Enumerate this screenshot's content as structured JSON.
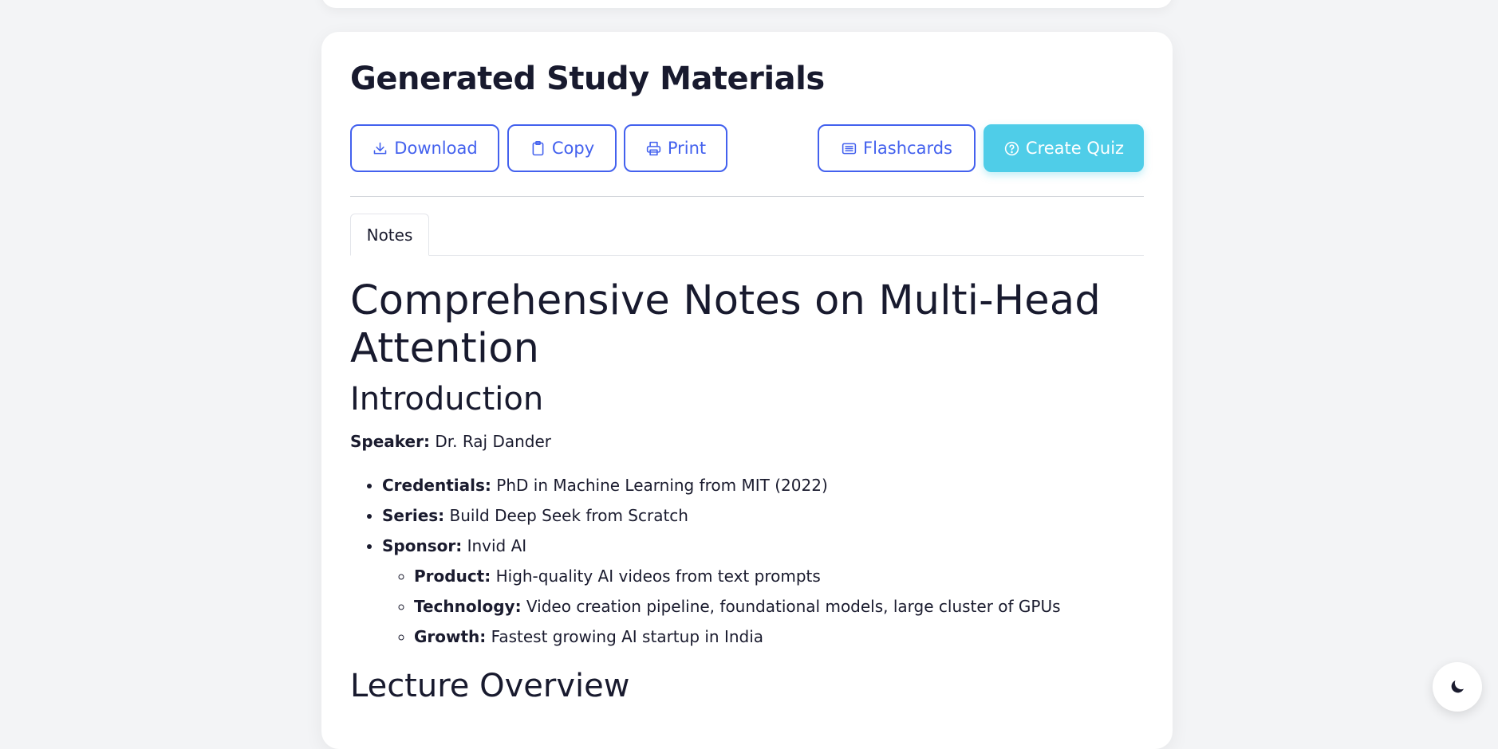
{
  "card": {
    "title": "Generated Study Materials"
  },
  "toolbar": {
    "download_label": "Download",
    "copy_label": "Copy",
    "print_label": "Print",
    "flashcards_label": "Flashcards",
    "quiz_label": "Create Quiz"
  },
  "tabs": [
    {
      "label": "Notes",
      "active": true
    }
  ],
  "notes": {
    "title": "Comprehensive Notes on Multi-Head Attention",
    "intro_heading": "Introduction",
    "speaker_label": "Speaker:",
    "speaker_value": " Dr. Raj Dander",
    "items": [
      {
        "label": "Credentials:",
        "value": " PhD in Machine Learning from MIT (2022)"
      },
      {
        "label": "Series:",
        "value": " Build Deep Seek from Scratch"
      },
      {
        "label": "Sponsor:",
        "value": " Invid AI"
      }
    ],
    "sponsor_details": [
      {
        "label": "Product:",
        "value": " High-quality AI videos from text prompts"
      },
      {
        "label": "Technology:",
        "value": " Video creation pipeline, foundational models, large cluster of GPUs"
      },
      {
        "label": "Growth:",
        "value": " Fastest growing AI startup in India"
      }
    ],
    "overview_heading": "Lecture Overview"
  },
  "icons": {
    "download": "download-icon",
    "copy": "clipboard-icon",
    "print": "printer-icon",
    "flashcards": "list-card-icon",
    "quiz": "question-circle-icon",
    "theme": "moon-icon"
  },
  "colors": {
    "accent": "#4361ee",
    "quiz_bg": "#4fcde8",
    "page_bg": "#f3f4f6",
    "text": "#1a1b2e"
  }
}
